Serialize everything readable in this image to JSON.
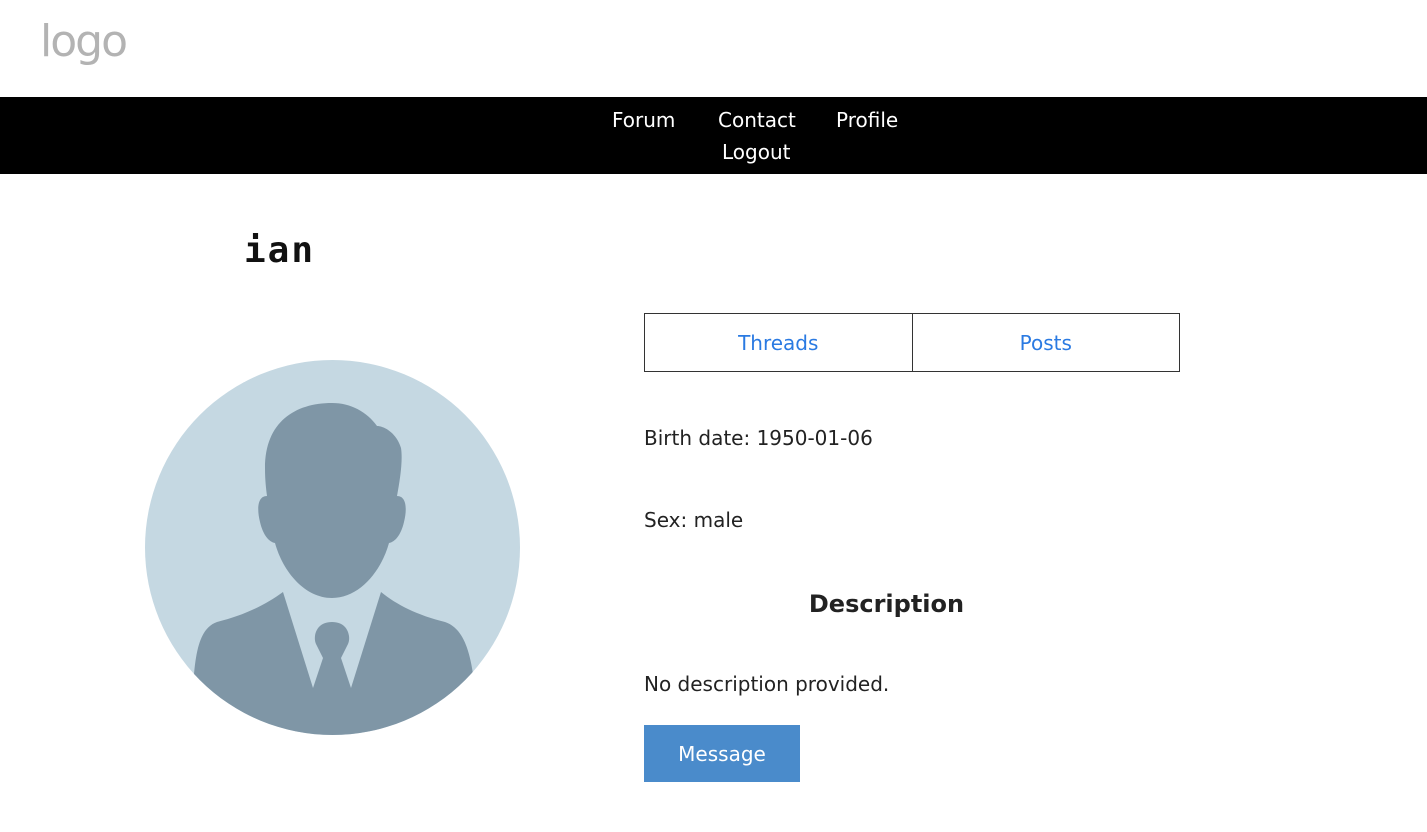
{
  "header": {
    "logo_text": "logo"
  },
  "nav": {
    "forum": "Forum",
    "contact": "Contact",
    "profile": "Profile",
    "logout": "Logout"
  },
  "profile": {
    "username": "ian",
    "tabs": [
      "Threads",
      "Posts"
    ],
    "birth_date": "Birth date: 1950-01-06",
    "sex": "Sex: male",
    "description_heading": "Description",
    "description_text": "No description provided.",
    "message_button": "Message"
  },
  "colors": {
    "navbar_bg": "#000000",
    "link": "#2a7ae2",
    "button_bg": "#4a8bcb",
    "avatar_bg": "#c5d8e2",
    "avatar_fg": "#7f96a6"
  }
}
